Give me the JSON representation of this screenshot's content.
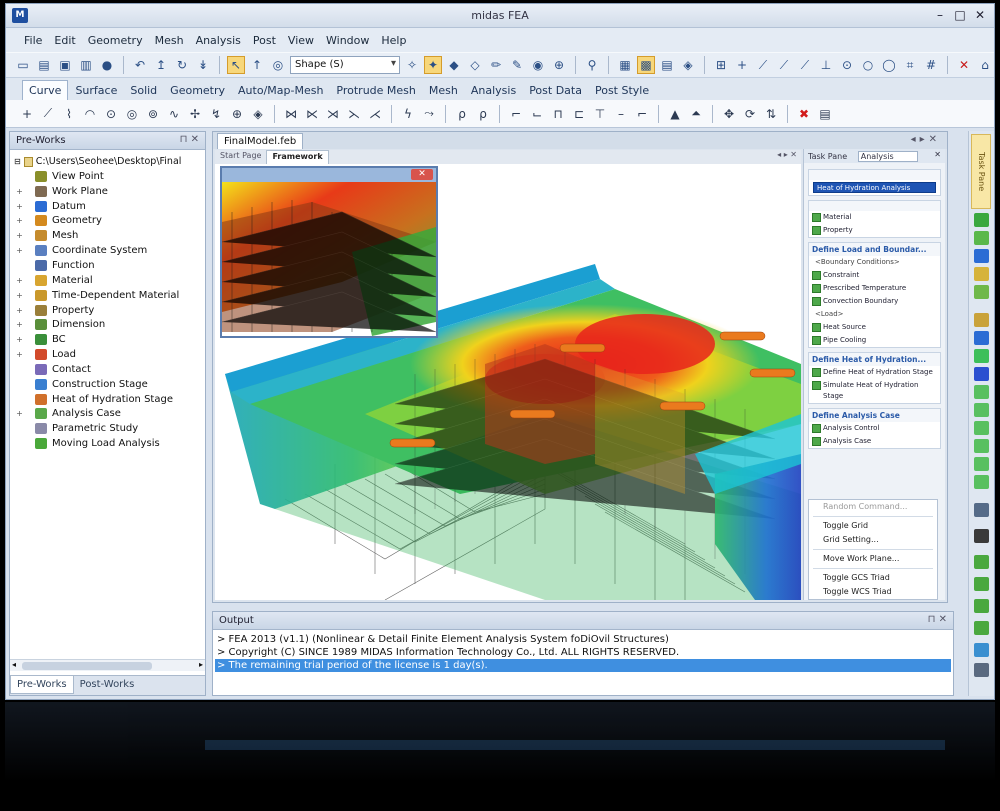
{
  "window": {
    "title": "midas FEA",
    "logo": "M",
    "controls": [
      "–",
      "□",
      "✕"
    ]
  },
  "menu": [
    "File",
    "Edit",
    "Geometry",
    "Mesh",
    "Analysis",
    "Post",
    "View",
    "Window",
    "Help"
  ],
  "toolbar": {
    "shape_select": "Shape (S)",
    "icons": [
      "new-file-icon",
      "open-file-icon",
      "save-icon",
      "print-icon",
      "help-icon",
      "undo-icon",
      "redo-icon",
      "pan-icon",
      "rotate-icon",
      "select-icon",
      "filter-icon",
      "select-all-icon"
    ]
  },
  "mode_tabs": [
    "Curve",
    "Surface",
    "Solid",
    "Geometry",
    "Auto/Map-Mesh",
    "Protrude Mesh",
    "Mesh",
    "Analysis",
    "Post Data",
    "Post Style"
  ],
  "preworks": {
    "title": "Pre-Works",
    "root_path": "C:\\Users\\Seohee\\Desktop\\Final",
    "items": [
      {
        "label": "View Point",
        "color": "#8a8f2a",
        "expand": ""
      },
      {
        "label": "Work Plane",
        "color": "#7f6a52",
        "expand": "+"
      },
      {
        "label": "Datum",
        "color": "#2b6cd4",
        "expand": "+"
      },
      {
        "label": "Geometry",
        "color": "#d48a1f",
        "expand": "+"
      },
      {
        "label": "Mesh",
        "color": "#c58b2d",
        "expand": "+"
      },
      {
        "label": "Coordinate System",
        "color": "#5a7fc0",
        "expand": "+"
      },
      {
        "label": "Function",
        "color": "#4b6aa8",
        "expand": ""
      },
      {
        "label": "Material",
        "color": "#d8a530",
        "expand": "+"
      },
      {
        "label": "Time-Dependent Material",
        "color": "#c9982b",
        "expand": "+"
      },
      {
        "label": "Property",
        "color": "#9a7f3a",
        "expand": "+"
      },
      {
        "label": "Dimension",
        "color": "#5a8f3a",
        "expand": "+"
      },
      {
        "label": "BC",
        "color": "#3a8f3a",
        "expand": "+"
      },
      {
        "label": "Load",
        "color": "#d24a2b",
        "expand": "+"
      },
      {
        "label": "Contact",
        "color": "#7a6ab8",
        "expand": ""
      },
      {
        "label": "Construction Stage",
        "color": "#3a7fd0",
        "expand": ""
      },
      {
        "label": "Heat of Hydration Stage",
        "color": "#d0702b",
        "expand": ""
      },
      {
        "label": "Analysis Case",
        "color": "#5aa84a",
        "expand": "+"
      },
      {
        "label": "Parametric Study",
        "color": "#8a8aa8",
        "expand": ""
      },
      {
        "label": "Moving Load Analysis",
        "color": "#4aa83a",
        "expand": ""
      }
    ],
    "tabs": [
      "Pre-Works",
      "Post-Works"
    ]
  },
  "doc": {
    "tab": "FinalModel.feb",
    "view_tabs": [
      "Start Page",
      "Framework"
    ]
  },
  "taskpane": {
    "title": "Task Pane",
    "mode": "Analysis",
    "selected": "Heat of Hydration Analysis",
    "groups": [
      {
        "title": "",
        "items": [
          "Material",
          "Property"
        ]
      },
      {
        "title": "Define Load and Boundar...",
        "items": [
          "<Boundary Conditions>",
          "Constraint",
          "Prescribed Temperature",
          "Convection Boundary",
          "<Load>",
          "Heat Source",
          "Pipe Cooling"
        ]
      },
      {
        "title": "Define Heat of Hydration...",
        "items": [
          "Define Heat of Hydration Stage",
          "Simulate Heat of Hydration Stage"
        ]
      },
      {
        "title": "Define Analysis Case",
        "items": [
          "Analysis Control",
          "Analysis Case"
        ]
      }
    ],
    "context_menu": [
      "Random Command...",
      "Toggle Grid",
      "Grid Setting...",
      "Move Work Plane...",
      "Toggle GCS Triad",
      "Toggle WCS Triad"
    ]
  },
  "output": {
    "title": "Output",
    "lines": [
      "> FEA 2013 (v1.1) (Nonlinear & Detail Finite Element Analysis System foDiOvil Structures)",
      "> Copyright (C) SINCE 1989 MIDAS Information Technology Co., Ltd. ALL RIGHTS RESERVED.",
      "> The remaining trial period of the license is 1 day(s)."
    ]
  },
  "rightbar": {
    "vertical_tab": "Task Pane"
  },
  "colors": {
    "accent": "#3f8fe0",
    "hot": "#e8251b",
    "cool": "#1c3fbf"
  }
}
